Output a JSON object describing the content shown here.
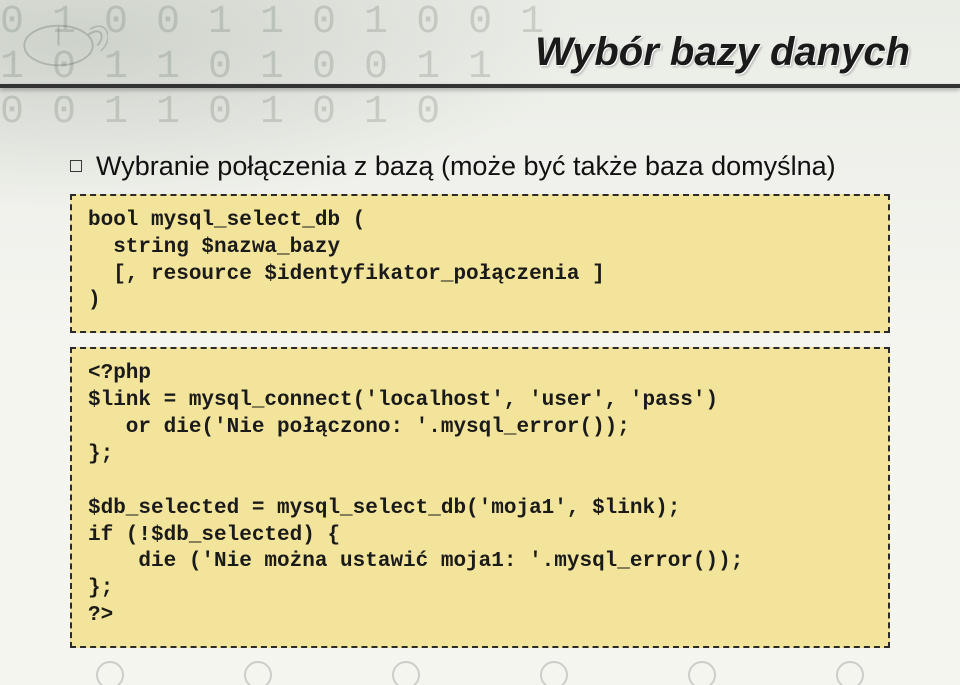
{
  "title": "Wybór bazy danych",
  "bullet": "Wybranie połączenia z bazą (może być także baza domyślna)",
  "code1": "bool mysql_select_db (\n  string $nazwa_bazy\n  [, resource $identyfikator_połączenia ]\n)",
  "code2": "<?php\n$link = mysql_connect('localhost', 'user', 'pass')\n   or die('Nie połączono: '.mysql_error());\n};\n\n$db_selected = mysql_select_db('moja1', $link);\nif (!$db_selected) {\n    die ('Nie można ustawić moja1: '.mysql_error());\n};\n?>",
  "bg_rows": [
    "0 1 0 0  1 1 0 1 0 0 1",
    " 1 0 1 1  0 1 0 0 1 1",
    "0 0 1  1 0 1 0 1 0"
  ]
}
